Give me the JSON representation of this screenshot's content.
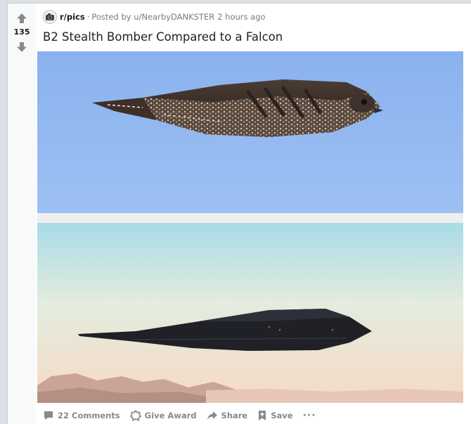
{
  "post": {
    "score": "135",
    "subreddit": "r/pics",
    "separator": "·",
    "posted_by": "Posted by u/NearbyDANKSTER",
    "time": "2 hours ago",
    "title": "B2 Stealth Bomber Compared to a Falcon"
  },
  "actions": {
    "comments": "22 Comments",
    "award": "Give Award",
    "share": "Share",
    "save": "Save",
    "more": "···"
  },
  "icons": {
    "upvote": "arrow-up-icon",
    "downvote": "arrow-down-icon",
    "comments": "comment-bubble-icon",
    "award": "award-icon",
    "share": "share-arrow-icon",
    "save": "bookmark-plus-icon"
  },
  "colors": {
    "vote_gray": "#878a8c",
    "sky_top": "#8eb6ef",
    "sky_bottom": "#f5dcc6"
  }
}
